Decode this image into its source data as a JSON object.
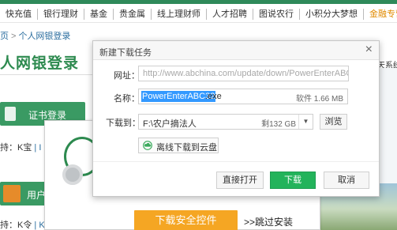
{
  "background": {
    "topnav": [
      "快充值",
      "银行理财",
      "基金",
      "贵金属",
      "线上理财师",
      "人才招聘",
      "图说农行",
      "小积分大梦想",
      "金融专营"
    ],
    "breadcrumb": {
      "home": "页",
      "sep": ">",
      "current": "个人网银登录"
    },
    "page_title": "人网银登录",
    "cert_button_label": "证书登录",
    "support_line_1": {
      "prefix": "持：K宝",
      "sep": "|",
      "more": "I"
    },
    "user_button_label": "用户",
    "support_line_2": {
      "prefix": "持：K令",
      "sep": "|",
      "more": "K"
    },
    "right_text": "天系统",
    "install_button_label": "下载安全控件",
    "install_skip_label": ">>跳过安装"
  },
  "dialog": {
    "title": "新建下载任务",
    "close_glyph": "×",
    "url_label": "网址：",
    "url_value": "http://www.abchina.com/update/down/PowerEnterABC32.e",
    "name_label": "名称：",
    "name_selected": "PowerEnterABC32",
    "name_extension": ".exe",
    "file_size": "软件 1.66 MB",
    "dest_label": "下载到：",
    "dest_path": "F:\\农户摘法人",
    "dest_free": "剩132 GB",
    "dest_dropdown_glyph": "▼",
    "browse_label": "浏览",
    "cloud_label": "离线下载到云盘",
    "open_label": "直接打开",
    "download_label": "下载",
    "cancel_label": "取消"
  },
  "colors": {
    "accent_green": "#23b35b",
    "page_green": "#2d8a4f",
    "selection_blue": "#3399ff",
    "install_orange": "#f5a623"
  },
  "icons": {
    "close": "close-icon",
    "dropdown": "chevron-down-icon",
    "cloud": "cloud-icon",
    "cert": "usb-key-icon",
    "user": "user-icon",
    "logo": "abc-logo-icon",
    "gear": "gear-icon"
  }
}
